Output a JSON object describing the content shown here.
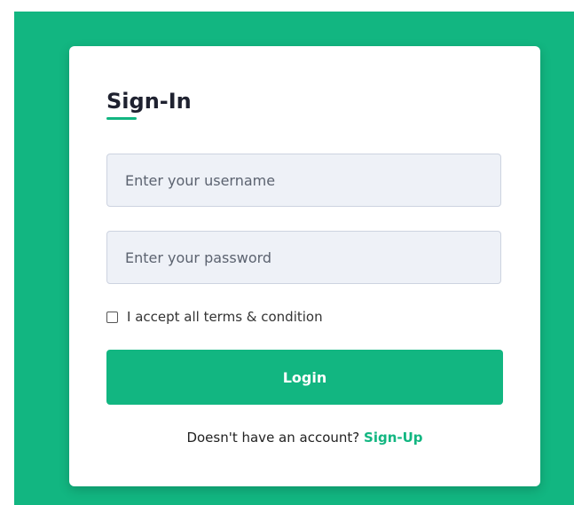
{
  "colors": {
    "accent": "#12b681",
    "input_bg": "#eef1f7",
    "title_color": "#1f2230"
  },
  "form": {
    "title": "Sign-In",
    "username_placeholder": "Enter your username",
    "password_placeholder": "Enter your password",
    "terms_label": "I accept all terms & condition",
    "terms_checked": false,
    "login_label": "Login",
    "signup_prompt": "Doesn't have an account?",
    "signup_link": "Sign-Up"
  }
}
